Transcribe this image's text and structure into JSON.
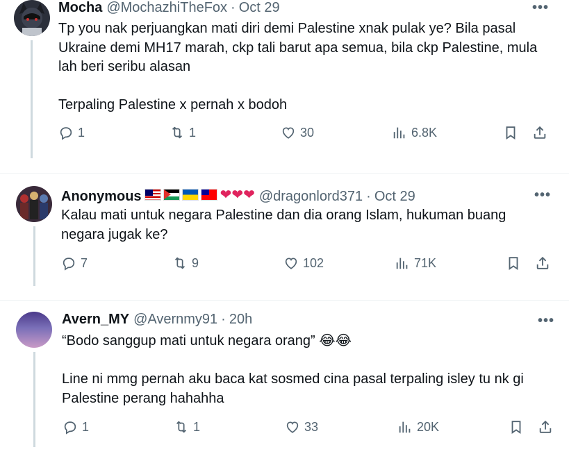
{
  "tweets": [
    {
      "name": "Mocha",
      "handle": "@MochazhiTheFox",
      "separator": "·",
      "time": "Oct 29",
      "more": "•••",
      "body": [
        "Tp you nak perjuangkan mati diri demi Palestine xnak pulak ye? Bila pasal Ukraine demi MH17 marah, ckp tali barut apa semua, bila ckp Palestine, mula lah beri seribu alasan",
        "Terpaling Palestine x pernah x bodoh"
      ],
      "replies": "1",
      "reposts": "1",
      "likes": "30",
      "views": "6.8K"
    },
    {
      "name": "Anonymous",
      "handle": "@dragonlord371",
      "separator": "·",
      "time": "Oct 29",
      "more": "•••",
      "hearts": "❤❤❤",
      "body": [
        "Kalau mati untuk negara Palestine dan dia orang Islam, hukuman buang negara jugak ke?"
      ],
      "replies": "7",
      "reposts": "9",
      "likes": "102",
      "views": "71K"
    },
    {
      "name": "Avern_MY",
      "handle": "@Avernmy91",
      "separator": "·",
      "time": "20h",
      "more": "•••",
      "body": [
        "“Bodo sanggup mati untuk negara orang” 😂😂",
        "Line ni mmg pernah aku baca kat sosmed cina pasal terpaling isley tu nk gi Palestine perang hahahha"
      ],
      "replies": "1",
      "reposts": "1",
      "likes": "33",
      "views": "20K"
    }
  ],
  "icons": {
    "reply": "reply-icon",
    "repost": "repost-icon",
    "like": "heart-icon",
    "views": "analytics-icon",
    "bookmark": "bookmark-icon",
    "share": "share-icon"
  },
  "colors": {
    "text": "#0f1419",
    "muted": "#536471",
    "thread": "#cfd9de",
    "heart": "#e0245e"
  }
}
